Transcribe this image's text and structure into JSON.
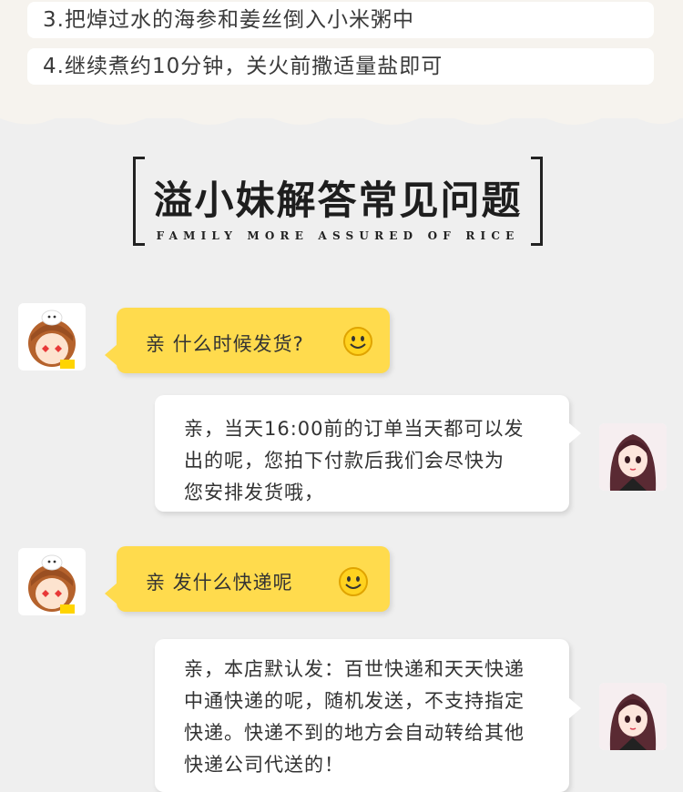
{
  "steps": {
    "step3": "3.把焯过水的海参和姜丝倒入小米粥中",
    "step4": "4.继续煮约10分钟，关火前撒适量盐即可"
  },
  "heading": {
    "title": "溢小妹解答常见问题",
    "subtitle": "FAMILY MORE ASSURED OF RICE"
  },
  "faq": [
    {
      "question": "亲  什么时候发货?",
      "answer": "亲，当天16:00前的订单当天都可以发\n出的呢，您拍下付款后我们会尽快为\n您安排发货哦，"
    },
    {
      "question": "亲  发什么快递呢",
      "answer": "亲，本店默认发：百世快递和天天快递\n中通快递的呢，随机发送，不支持指定\n快递。快递不到的地方会自动转给其他\n快递公司代送的！"
    }
  ],
  "icons": {
    "customer_avatar": "cartoon-girl-avatar",
    "service_avatar": "service-girl-avatar",
    "emoji": "smiley-face-icon"
  },
  "colors": {
    "question_bubble": "#ffdb4d",
    "answer_bubble": "#ffffff",
    "page_bg": "#efefef"
  }
}
